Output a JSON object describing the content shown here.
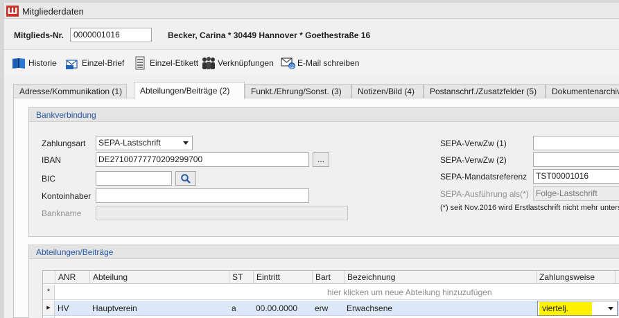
{
  "window": {
    "title": "Mitgliederdaten"
  },
  "header": {
    "member_nr_label": "Mitglieds-Nr.",
    "member_nr_value": "0000001016",
    "member_info": "Becker, Carina * 30449 Hannover * Goethestraße 16"
  },
  "toolbar": {
    "items": [
      {
        "label": "Historie",
        "icon": "book-icon"
      },
      {
        "label": "Einzel-Brief",
        "icon": "letter-icon"
      },
      {
        "label": "Einzel-Etikett",
        "icon": "label-icon"
      },
      {
        "label": "Verknüpfungen",
        "icon": "people-icon"
      },
      {
        "label": "E-Mail schreiben",
        "icon": "email-icon"
      }
    ]
  },
  "tabs": [
    {
      "label": "Adresse/Kommunikation (1)",
      "active": false
    },
    {
      "label": "Abteilungen/Beiträge (2)",
      "active": true
    },
    {
      "label": "Funkt./Ehrung/Sonst. (3)",
      "active": false
    },
    {
      "label": "Notizen/Bild (4)",
      "active": false
    },
    {
      "label": "Postanschrf./Zusatzfelder (5)",
      "active": false
    },
    {
      "label": "Dokumentenarchiv",
      "active": false
    }
  ],
  "bank": {
    "title": "Bankverbindung",
    "zahlungsart_label": "Zahlungsart",
    "zahlungsart_value": "SEPA-Lastschrift",
    "iban_label": "IBAN",
    "iban_value": "DE27100777770209299700",
    "iban_button": "...",
    "bic_label": "BIC",
    "bic_value": "",
    "kontoinhaber_label": "Kontoinhaber",
    "kontoinhaber_value": "",
    "bankname_label": "Bankname",
    "bankname_value": "",
    "verwzw1_label": "SEPA-VerwZw (1)",
    "verwzw1_value": "",
    "verwzw2_label": "SEPA-VerwZw (2)",
    "verwzw2_value": "",
    "mandat_label": "SEPA-Mandatsreferenz",
    "mandat_value": "TST00001016",
    "ausfuehrung_label": "SEPA-Ausführung als(*)",
    "ausfuehrung_value": "Folge-Lastschrift",
    "note": "(*) seit Nov.2016 wird Erstlastschrift nicht mehr unters"
  },
  "abteilungen": {
    "title": "Abteilungen/Beiträge",
    "columns": [
      "ANR",
      "Abteilung",
      "ST",
      "Eintritt",
      "Bart",
      "Bezeichnung",
      "Zahlungsweise"
    ],
    "new_row_marker": "*",
    "new_row_hint": "hier klicken um neue Abteilung hinzuzufügen",
    "rows": [
      {
        "anr": "HV",
        "abteilung": "Hauptverein",
        "st": "a",
        "eintritt": "00.00.0000",
        "bart": "erw",
        "bezeichnung": "Erwachsene",
        "zahlungsweise": "viertelj."
      }
    ],
    "highlight_color": "#fff200"
  }
}
